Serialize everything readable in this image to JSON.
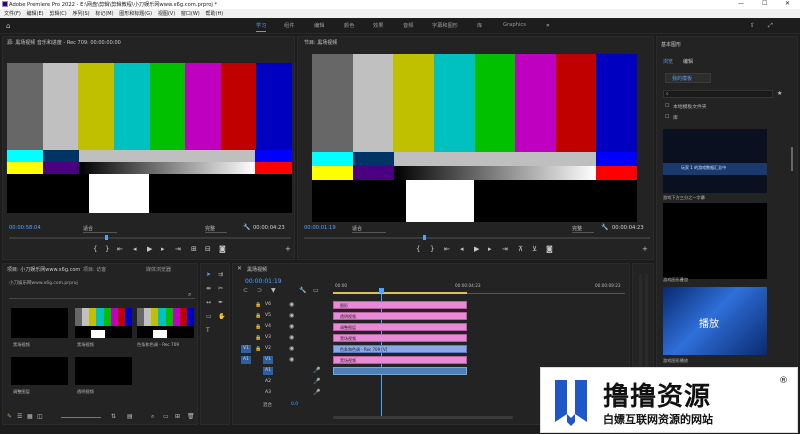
{
  "window": {
    "title": "Adobe Premiere Pro 2022 - E:\\网盘\\剪辑\\剪辑教程\\小刀娱乐网www.x6g.com.prproj *"
  },
  "menu": [
    "文件(F)",
    "编辑(E)",
    "剪辑(C)",
    "序列(S)",
    "标记(M)",
    "图形和标题(G)",
    "视图(V)",
    "窗口(W)",
    "帮助(H)"
  ],
  "workspaces": [
    {
      "label": "学习",
      "active": true
    },
    {
      "label": "组件",
      "active": false
    },
    {
      "label": "编辑",
      "active": false
    },
    {
      "label": "颜色",
      "active": false
    },
    {
      "label": "效果",
      "active": false
    },
    {
      "label": "音频",
      "active": false
    },
    {
      "label": "字幕和图形",
      "active": false
    },
    {
      "label": "库",
      "active": false
    },
    {
      "label": "Graphics",
      "active": false
    }
  ],
  "source_monitor": {
    "title": "源: 黑场视频  音乐和进度 - Rec 709: 00:00:00:00",
    "timecode": "00:00:58:04",
    "fit": "适合",
    "quality": "完整",
    "duration": "00:00:04:23"
  },
  "program_monitor": {
    "title": "节目: 黑场视频",
    "timecode": "00:00:01:19",
    "fit": "适合",
    "quality": "完整",
    "duration": "00:00:04:23"
  },
  "colorbars": {
    "top": [
      "#676767",
      "#c0c0c0",
      "#c0c000",
      "#00c0c0",
      "#00c000",
      "#c000c0",
      "#c00000",
      "#0000c0"
    ],
    "strip_left": [
      "#00ffff",
      "#003366",
      "#ffffff"
    ],
    "strip_right": [
      "#ff0000",
      "#ffff00"
    ]
  },
  "project_panel": {
    "tabs": [
      "项目: 小刀娱乐网www.x6g.com",
      "项目: 访客",
      "媒体浏览器"
    ],
    "path": "小刀娱乐网www.x6g.com.prproj",
    "items": [
      {
        "name": "黑场视频",
        "len": ""
      },
      {
        "name": "黑场视频",
        "len": ""
      },
      {
        "name": "色条和色调 - Rec 709",
        "len": ""
      },
      {
        "name": "调整图层",
        "len": ""
      },
      {
        "name": "透明视频",
        "len": ""
      }
    ]
  },
  "timeline": {
    "title": "黑场视频",
    "timecode": "00:00:01:19",
    "ruler": [
      "00:00",
      "00:00:04:23",
      "00:00:09:23"
    ],
    "video_tracks": [
      "V6",
      "V5",
      "V4",
      "V3",
      "V2",
      "V1"
    ],
    "audio_tracks": [
      "A1",
      "A2",
      "A3"
    ],
    "mix": "混合",
    "mix_value": "0.0",
    "clips": [
      {
        "label": "图形",
        "color": "#e88ad8"
      },
      {
        "label": "透明视频",
        "color": "#e88ad8"
      },
      {
        "label": "调整图层",
        "color": "#e88ad8"
      },
      {
        "label": "黑场视频",
        "color": "#e88ad8"
      },
      {
        "label": "色条和色调 - Rec 709 [V]",
        "color": "#8aa8e8"
      },
      {
        "label": "黑场视频",
        "color": "#e88ad8"
      }
    ]
  },
  "essential_graphics": {
    "title": "基本图形",
    "tabs": [
      "浏览",
      "编辑"
    ],
    "my_templates": "我的模板",
    "search_placeholder": "",
    "local_folder": "本地模板文件夹",
    "library": "库",
    "templates": [
      {
        "caption": "游戏下方三分之一字幕",
        "overlay": "玩家 1  的游戏数据汇总中"
      },
      {
        "caption": "游戏图形叠加",
        "overlay": ""
      },
      {
        "caption": "游戏图形播放",
        "overlay": "播放"
      }
    ]
  },
  "watermark": {
    "title": "撸撸资源",
    "subtitle": "白嫖互联网资源的网站",
    "reg": "®"
  }
}
